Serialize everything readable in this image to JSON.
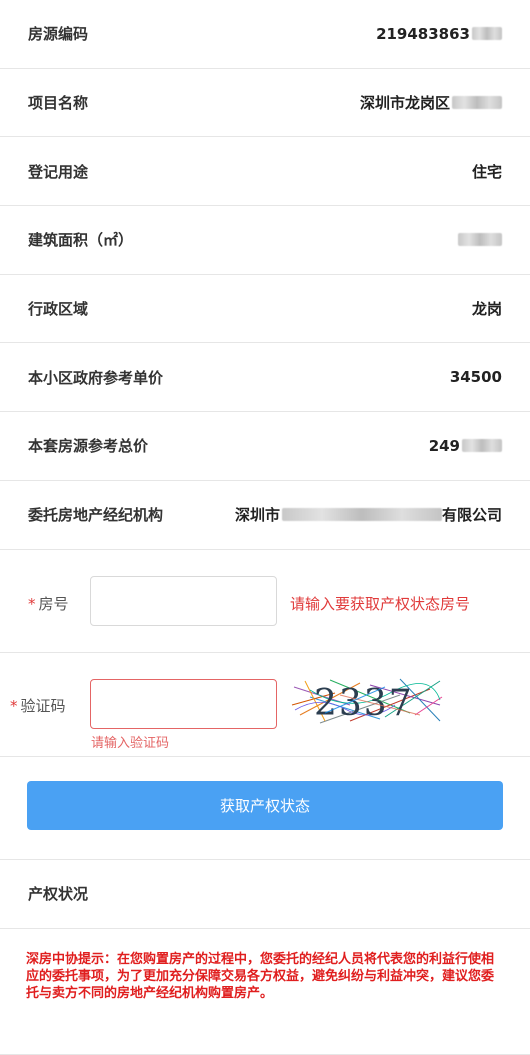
{
  "details": {
    "rows": [
      {
        "label": "房源编码",
        "value": "219483863"
      },
      {
        "label": "项目名称",
        "value": "深圳市龙岗区"
      },
      {
        "label": "登记用途",
        "value": "住宅"
      },
      {
        "label": "建筑面积（㎡）",
        "value": ""
      },
      {
        "label": "行政区域",
        "value": "龙岗"
      },
      {
        "label": "本小区政府参考单价",
        "value": "34500"
      },
      {
        "label": "本套房源参考总价",
        "value": "249"
      },
      {
        "label": "委托房地产经纪机构",
        "value_prefix": "深圳市",
        "value_suffix": "有限公司"
      }
    ]
  },
  "form": {
    "room": {
      "required_mark": "*",
      "label": "房号",
      "value": "",
      "hint": "请输入要获取产权状态房号"
    },
    "captcha": {
      "required_mark": "*",
      "label": "验证码",
      "value": "",
      "error": "请输入验证码",
      "image_text": "2337"
    },
    "submit_label": "获取产权状态"
  },
  "status": {
    "label": "产权状况"
  },
  "notice": {
    "text": "深房中协提示：在您购置房产的过程中，您委托的经纪人员将代表您的利益行使相应的委托事项，为了更加充分保障交易各方权益，避免纠纷与利益冲突，建议您委托与卖方不同的房地产经纪机构购置房产。"
  },
  "colors": {
    "primary": "#4aa1f3",
    "error": "#e03b3b",
    "notice": "#e01e1e"
  }
}
